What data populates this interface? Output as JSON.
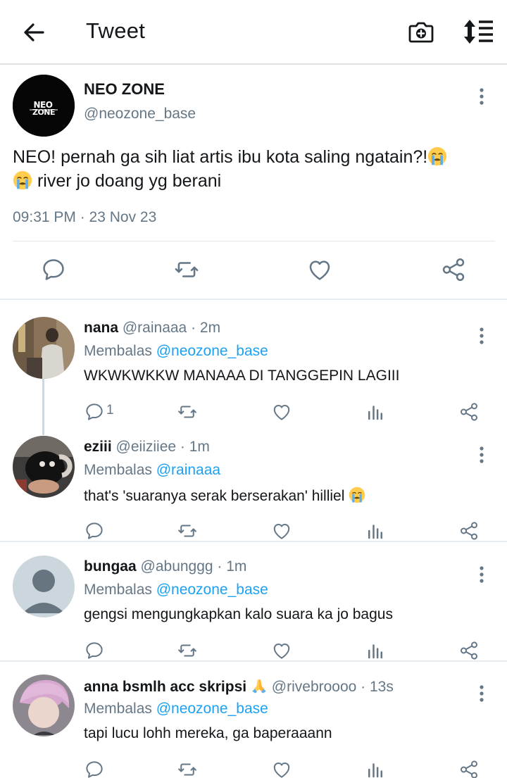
{
  "header": {
    "title": "Tweet"
  },
  "tweet": {
    "name": "NEO ZONE",
    "avatar_logo": "NEO ZONE",
    "handle": "@neozone_base",
    "text_part1": "NEO! pernah ga sih liat artis ibu kota saling ngatain?!",
    "text_part2": " river jo doang yg berani",
    "timestamp": "09:31 PM · 23 Nov 23",
    "emoji": "loudly-crying-face"
  },
  "replies": [
    {
      "name": "nana",
      "handle": "@rainaaa",
      "time": " · 2m",
      "replying_label": "Membalas ",
      "replying_to": "@neozone_base",
      "text": "WKWKWKKW MANAAA DI TANGGEPIN LAGIII",
      "reply_count": "1",
      "avatar": "photo"
    },
    {
      "name": "eziii",
      "handle": "@eiiziiee",
      "time": " · 1m",
      "replying_label": "Membalas ",
      "replying_to": "@rainaaa",
      "text": "that's 'suaranya serak berserakan' hilliel ",
      "avatar": "photo"
    },
    {
      "name": "bungaa",
      "handle": "@abunggg",
      "time": " · 1m",
      "replying_label": "Membalas ",
      "replying_to": "@neozone_base",
      "text": "gengsi mengungkapkan kalo suara ka jo bagus",
      "avatar": "default-person"
    },
    {
      "name": "anna bsmlh acc skripsi",
      "handle": "@rivebroooo",
      "time": " · 13s",
      "replying_label": "Membalas ",
      "replying_to": "@neozone_base",
      "text": "tapi lucu lohh mereka, ga baperaaann",
      "avatar": "photo",
      "name_emoji": "folded-hands"
    }
  ],
  "colors": {
    "link": "#1da1f2",
    "secondary_text": "#657786",
    "icon": "#657786",
    "divider": "#e6ecf0"
  },
  "icons": [
    "back-arrow-icon",
    "camera-add-icon",
    "sort-icon",
    "more-vertical-icon",
    "comment-icon",
    "retweet-icon",
    "like-icon",
    "share-icon",
    "analytics-icon"
  ]
}
